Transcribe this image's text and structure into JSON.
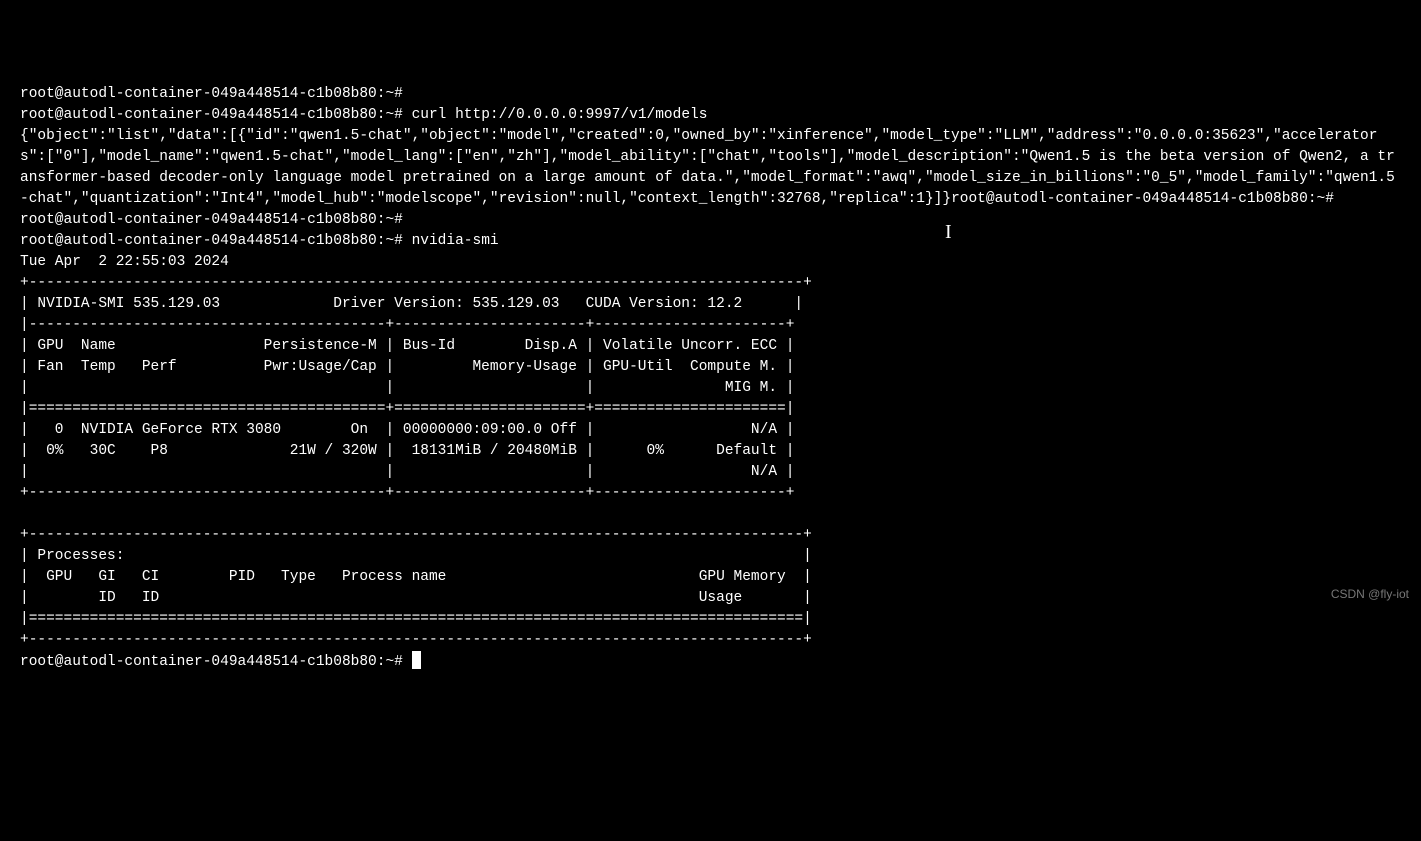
{
  "prompt": "root@autodl-container-049a448514-c1b08b80:~#",
  "curl_cmd": "curl http://0.0.0.0:9997/v1/models",
  "curl_response": "{\"object\":\"list\",\"data\":[{\"id\":\"qwen1.5-chat\",\"object\":\"model\",\"created\":0,\"owned_by\":\"xinference\",\"model_type\":\"LLM\",\"address\":\"0.0.0.0:35623\",\"accelerators\":[\"0\"],\"model_name\":\"qwen1.5-chat\",\"model_lang\":[\"en\",\"zh\"],\"model_ability\":[\"chat\",\"tools\"],\"model_description\":\"Qwen1.5 is the beta version of Qwen2, a transformer-based decoder-only language model pretrained on a large amount of data.\",\"model_format\":\"awq\",\"model_size_in_billions\":\"0_5\",\"model_family\":\"qwen1.5-chat\",\"quantization\":\"Int4\",\"model_hub\":\"modelscope\",\"revision\":null,\"context_length\":32768,\"replica\":1}]}",
  "nvidia_cmd": "nvidia-smi",
  "nvidia_date": "Tue Apr  2 22:55:03 2024",
  "smi_border_top": "+-----------------------------------------------------------------------------------------+",
  "smi_header": "| NVIDIA-SMI 535.129.03             Driver Version: 535.129.03   CUDA Version: 12.2      |",
  "smi_sep_inner": "|-----------------------------------------+----------------------+----------------------+",
  "smi_col_header1": "| GPU  Name                 Persistence-M | Bus-Id        Disp.A | Volatile Uncorr. ECC |",
  "smi_col_header2": "| Fan  Temp   Perf          Pwr:Usage/Cap |         Memory-Usage | GPU-Util  Compute M. |",
  "smi_col_header3": "|                                         |                      |               MIG M. |",
  "smi_sep_double": "|=========================================+======================+======================|",
  "smi_gpu_row1": "|   0  NVIDIA GeForce RTX 3080        On  | 00000000:09:00.0 Off |                  N/A |",
  "smi_gpu_row2": "|  0%   30C    P8              21W / 320W |  18131MiB / 20480MiB |      0%      Default |",
  "smi_gpu_row3": "|                                         |                      |                  N/A |",
  "smi_border_mid": "+-----------------------------------------+----------------------+----------------------+",
  "smi_proc_top": "+-----------------------------------------------------------------------------------------+",
  "smi_proc_head": "| Processes:                                                                              |",
  "smi_proc_cols1": "|  GPU   GI   CI        PID   Type   Process name                             GPU Memory  |",
  "smi_proc_cols2": "|        ID   ID                                                              Usage       |",
  "smi_proc_sep": "|=========================================================================================|",
  "smi_border_bot": "+-----------------------------------------------------------------------------------------+",
  "watermark": "CSDN @fly-iot"
}
